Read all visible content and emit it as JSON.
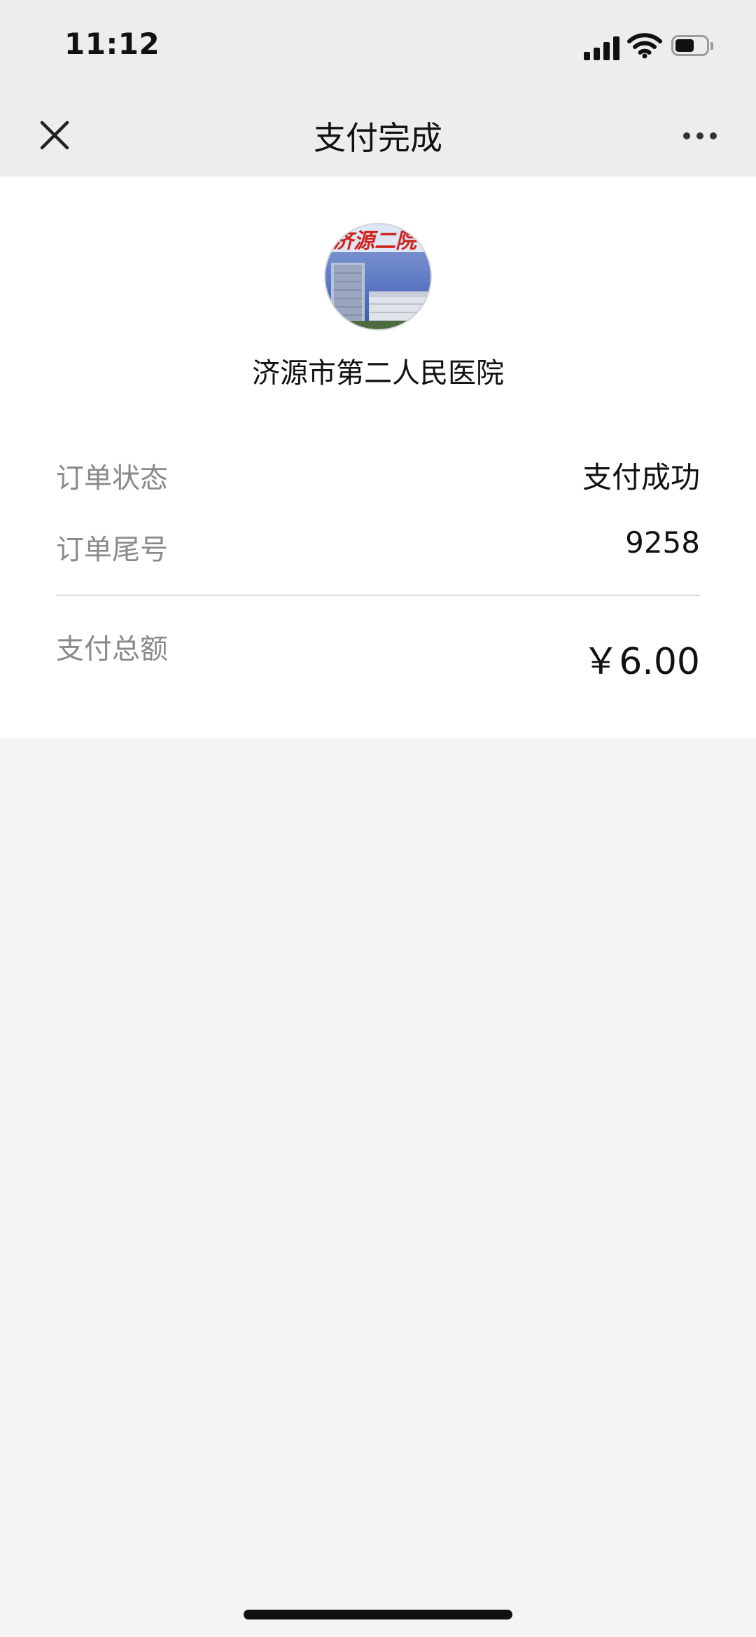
{
  "status_bar": {
    "time": "11:12",
    "icons": [
      "signal-icon",
      "wifi-icon",
      "battery-icon"
    ],
    "battery_level_fraction": 0.5
  },
  "nav": {
    "title": "支付完成",
    "close_icon": "close-icon",
    "more_icon": "more-icon"
  },
  "merchant": {
    "name": "济源市第二人民医院",
    "logo_text": "济源二院"
  },
  "details": {
    "order_status_label": "订单状态",
    "order_status_value": "支付成功",
    "order_tail_label": "订单尾号",
    "order_tail_value": "9258",
    "total_label": "支付总额",
    "total_value": "￥6.00"
  },
  "colors": {
    "header_bg": "#ededed",
    "page_bg": "#f4f4f6",
    "card_bg": "#ffffff",
    "label_gray": "#8a8a8a"
  }
}
